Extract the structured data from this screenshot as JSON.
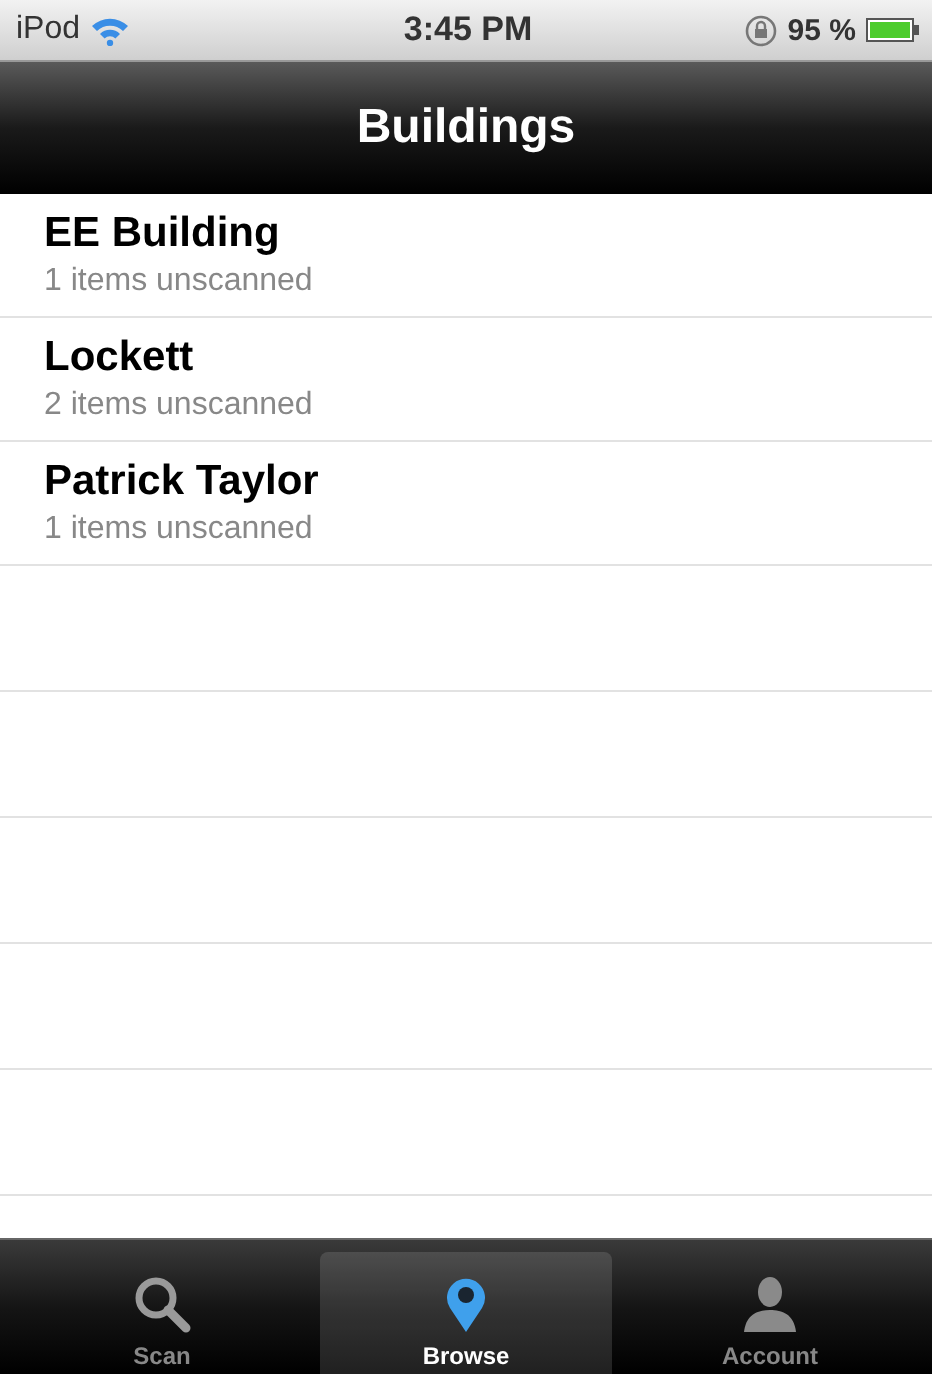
{
  "status_bar": {
    "device": "iPod",
    "time": "3:45 PM",
    "battery": "95 %"
  },
  "nav_bar": {
    "title": "Buildings"
  },
  "rows": [
    {
      "title": "EE Building",
      "subtitle": "1 items unscanned"
    },
    {
      "title": "Lockett",
      "subtitle": "2 items unscanned"
    },
    {
      "title": "Patrick Taylor",
      "subtitle": "1 items unscanned"
    }
  ],
  "tab_bar": [
    {
      "label": "Scan",
      "selected": false
    },
    {
      "label": "Browse",
      "selected": true
    },
    {
      "label": "Account",
      "selected": false
    }
  ]
}
